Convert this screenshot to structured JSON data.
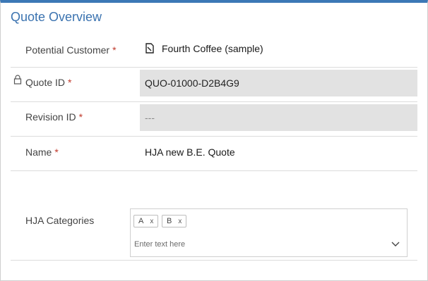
{
  "section": {
    "title": "Quote Overview"
  },
  "fields": {
    "potential_customer": {
      "label": "Potential Customer",
      "required": "*",
      "value": "Fourth Coffee (sample)"
    },
    "quote_id": {
      "label": "Quote ID",
      "required": "*",
      "value": "QUO-01000-D2B4G9"
    },
    "revision_id": {
      "label": "Revision ID",
      "required": "*",
      "value": "---"
    },
    "name": {
      "label": "Name",
      "required": "*",
      "value": "HJA new B.E. Quote"
    },
    "hja_categories": {
      "label": "HJA Categories",
      "tags": [
        {
          "label": "A",
          "remove": "x"
        },
        {
          "label": "B",
          "remove": "x"
        }
      ],
      "placeholder": "Enter text here"
    }
  },
  "icons": {
    "lock": "lock-icon",
    "record": "record-icon",
    "chevron": "chevron-down-icon"
  },
  "colors": {
    "accent": "#3c78b6",
    "required": "#c0392b",
    "readonly_bg": "#e2e2e2"
  }
}
